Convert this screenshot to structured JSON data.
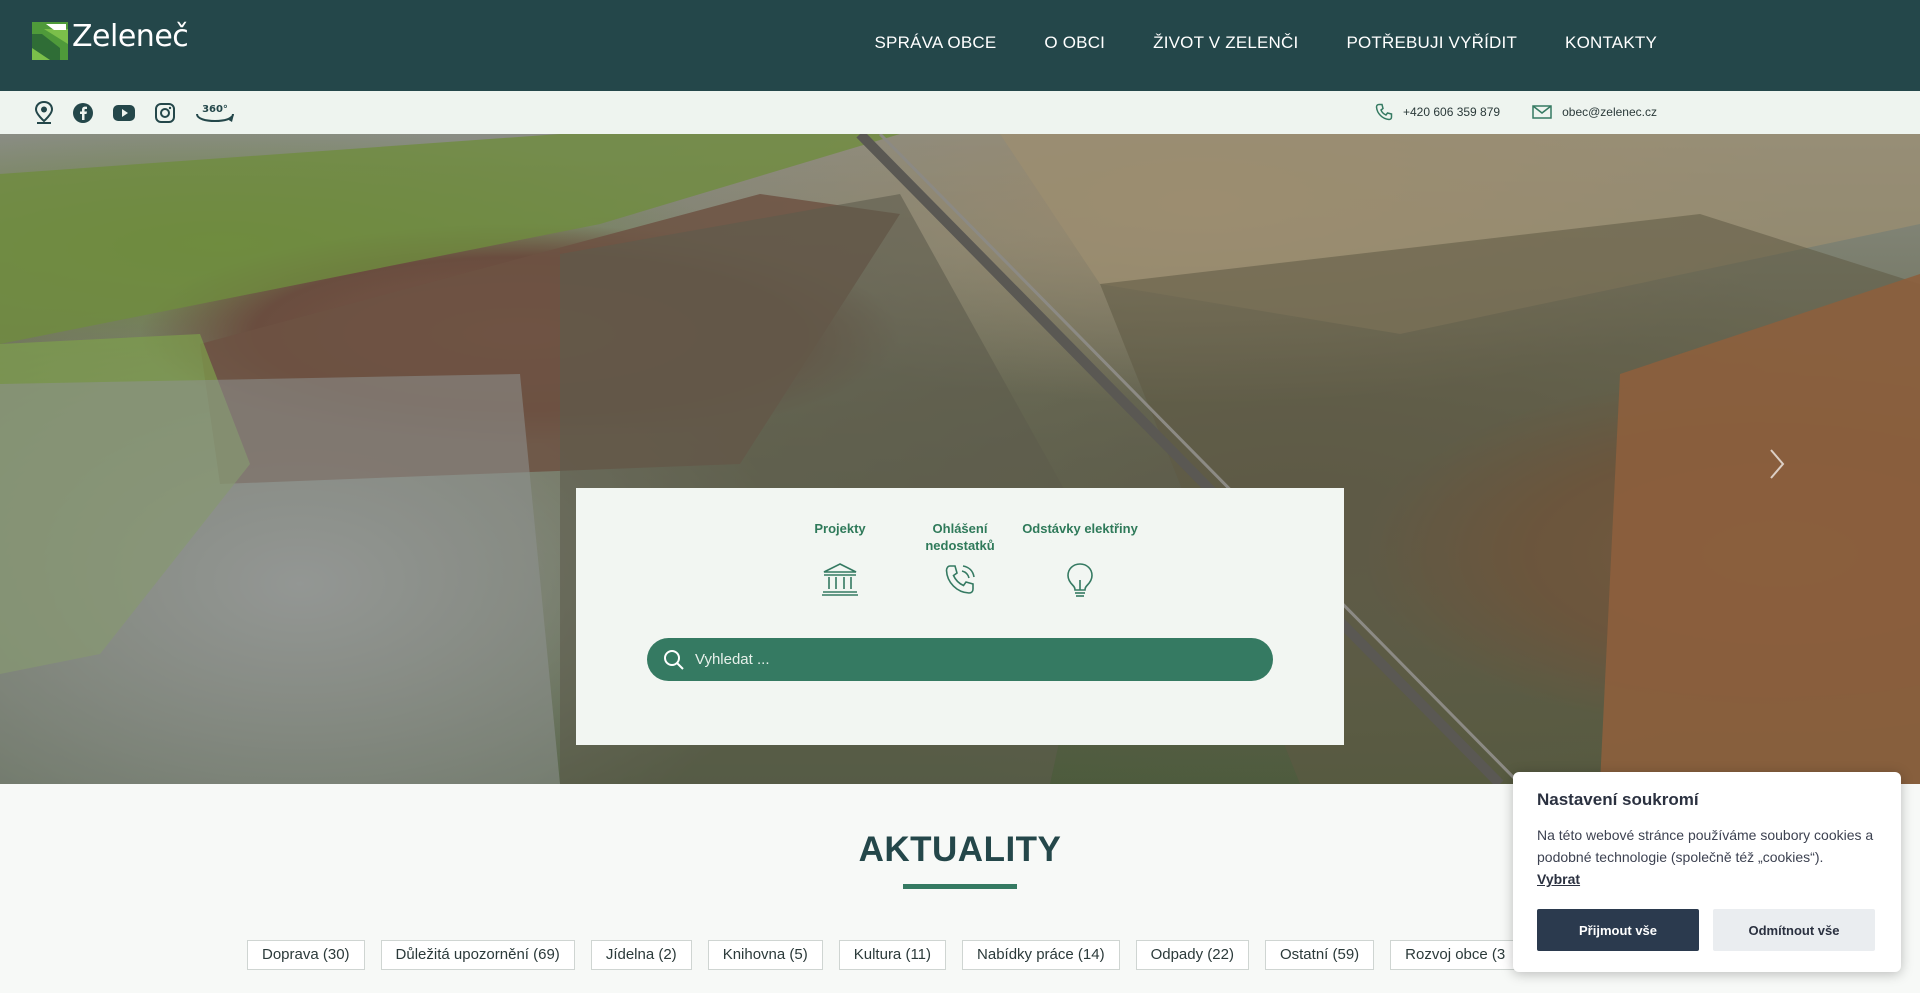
{
  "brand": {
    "logo_text": "Zeleneč",
    "accent": "#357a62",
    "dark": "#24474a"
  },
  "nav": {
    "items": [
      {
        "label": "SPRÁVA OBCE"
      },
      {
        "label": "O OBCI"
      },
      {
        "label": "ŽIVOT V ZELENČI"
      },
      {
        "label": "POTŘEBUJI VYŘÍDIT"
      },
      {
        "label": "KONTAKTY"
      }
    ]
  },
  "social": {
    "icons": [
      "map-pin-icon",
      "facebook-icon",
      "youtube-icon",
      "instagram-icon",
      "360-view-icon"
    ],
    "label_360": "360°"
  },
  "contact": {
    "phone": "+420 606 359 879",
    "email": "obec@zelenec.cz"
  },
  "quick_links": [
    {
      "label": "Projekty",
      "icon": "bank-building-icon"
    },
    {
      "label": "Ohlášení nedostatků",
      "icon": "phone-call-icon"
    },
    {
      "label": "Odstávky elektřiny",
      "icon": "lightbulb-icon"
    }
  ],
  "search": {
    "placeholder": "Vyhledat ..."
  },
  "aktuality": {
    "title": "AKTUALITY",
    "categories": [
      "Doprava (30)",
      "Důležitá upozornění (69)",
      "Jídelna (2)",
      "Knihovna (5)",
      "Kultura (11)",
      "Nabídky práce (14)",
      "Odpady (22)",
      "Ostatní (59)",
      "Rozvoj obce (3"
    ]
  },
  "cookie": {
    "title": "Nastavení soukromí",
    "text": "Na této webové stránce používáme soubory cookies a podobné technologie (společně též „cookies“).",
    "link": "Vybrat",
    "accept": "Přijmout vše",
    "reject": "Odmítnout vše"
  }
}
